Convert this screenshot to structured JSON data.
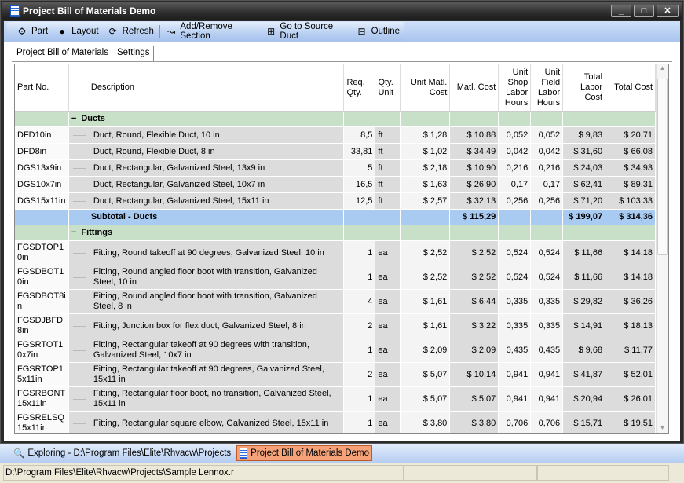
{
  "window": {
    "title": "Project Bill of Materials Demo",
    "controls": [
      "_",
      "□",
      "✕"
    ]
  },
  "toolbar": [
    {
      "label": "Part",
      "icon": "part-icon",
      "glyph": "⚙"
    },
    {
      "label": "Layout",
      "icon": "layout-icon",
      "glyph": "●"
    },
    {
      "label": "Refresh",
      "icon": "refresh-icon",
      "glyph": "⟳"
    },
    {
      "label": "Add/Remove Section",
      "icon": "add-remove-section-icon",
      "glyph": "↝"
    },
    {
      "label": "Go to Source Duct",
      "icon": "source-duct-icon",
      "glyph": "⊞"
    },
    {
      "label": "Outline",
      "icon": "outline-icon",
      "glyph": "⊟"
    }
  ],
  "tabs": [
    {
      "label": "Project Bill of Materials",
      "active": true
    },
    {
      "label": "Settings",
      "active": false
    }
  ],
  "table": {
    "columns": [
      "Part No.",
      "Description",
      "Req. Qty.",
      "Qty. Unit",
      "Unit Matl. Cost",
      "Matl. Cost",
      "Unit Shop Labor Hours",
      "Unit Field Labor Hours",
      "Total Labor Cost",
      "Total Cost"
    ],
    "rows": [
      {
        "type": "section",
        "label": "Ducts",
        "toggle": "−"
      },
      {
        "type": "item",
        "cells": [
          "DFD10in",
          "Duct, Round, Flexible Duct, 10 in",
          "8,5",
          "ft",
          "$ 1,28",
          "$ 10,88",
          "0,052",
          "0,052",
          "$ 9,83",
          "$ 20,71"
        ]
      },
      {
        "type": "item",
        "cells": [
          "DFD8in",
          "Duct, Round, Flexible Duct, 8 in",
          "33,81",
          "ft",
          "$ 1,02",
          "$ 34,49",
          "0,042",
          "0,042",
          "$ 31,60",
          "$ 66,08"
        ]
      },
      {
        "type": "item",
        "cells": [
          "DGS13x9in",
          "Duct, Rectangular, Galvanized Steel, 13x9 in",
          "5",
          "ft",
          "$ 2,18",
          "$ 10,90",
          "0,216",
          "0,216",
          "$ 24,03",
          "$ 34,93"
        ]
      },
      {
        "type": "item",
        "cells": [
          "DGS10x7in",
          "Duct, Rectangular, Galvanized Steel, 10x7 in",
          "16,5",
          "ft",
          "$ 1,63",
          "$ 26,90",
          "0,17",
          "0,17",
          "$ 62,41",
          "$ 89,31"
        ]
      },
      {
        "type": "item",
        "cells": [
          "DGS15x11in",
          "Duct, Rectangular, Galvanized Steel, 15x11 in",
          "12,5",
          "ft",
          "$ 2,57",
          "$ 32,13",
          "0,256",
          "0,256",
          "$ 71,20",
          "$ 103,33"
        ]
      },
      {
        "type": "subtotal",
        "cells": [
          "",
          "Subtotal - Ducts",
          "",
          "",
          "",
          "$ 115,29",
          "",
          "",
          "$ 199,07",
          "$ 314,36"
        ]
      },
      {
        "type": "section",
        "label": "Fittings",
        "toggle": "−"
      },
      {
        "type": "item",
        "tall": true,
        "cells": [
          "FGSDTOP10in",
          "Fitting, Round takeoff at 90 degrees, Galvanized Steel, 10 in",
          "1",
          "ea",
          "$ 2,52",
          "$ 2,52",
          "0,524",
          "0,524",
          "$ 11,66",
          "$ 14,18"
        ]
      },
      {
        "type": "item",
        "tall": true,
        "cells": [
          "FGSDBOT10in",
          "Fitting, Round angled floor boot with transition, Galvanized Steel, 10 in",
          "1",
          "ea",
          "$ 2,52",
          "$ 2,52",
          "0,524",
          "0,524",
          "$ 11,66",
          "$ 14,18"
        ]
      },
      {
        "type": "item",
        "tall": true,
        "cells": [
          "FGSDBOT8in",
          "Fitting, Round angled floor boot with transition, Galvanized Steel, 8 in",
          "4",
          "ea",
          "$ 1,61",
          "$ 6,44",
          "0,335",
          "0,335",
          "$ 29,82",
          "$ 36,26"
        ]
      },
      {
        "type": "item",
        "tall": true,
        "cells": [
          "FGSDJBFD8in",
          "Fitting, Junction box for flex duct, Galvanized Steel, 8 in",
          "2",
          "ea",
          "$ 1,61",
          "$ 3,22",
          "0,335",
          "0,335",
          "$ 14,91",
          "$ 18,13"
        ]
      },
      {
        "type": "item",
        "tall": true,
        "cells": [
          "FGSRTOT10x7in",
          "Fitting, Rectangular takeoff at 90 degrees with transition, Galvanized Steel, 10x7 in",
          "1",
          "ea",
          "$ 2,09",
          "$ 2,09",
          "0,435",
          "0,435",
          "$ 9,68",
          "$ 11,77"
        ]
      },
      {
        "type": "item",
        "tall": true,
        "cells": [
          "FGSRTOP15x11in",
          "Fitting, Rectangular takeoff at 90 degrees, Galvanized Steel, 15x11 in",
          "2",
          "ea",
          "$ 5,07",
          "$ 10,14",
          "0,941",
          "0,941",
          "$ 41,87",
          "$ 52,01"
        ]
      },
      {
        "type": "item",
        "tall": true,
        "cells": [
          "FGSRBONT15x11in",
          "Fitting, Rectangular floor boot, no transition, Galvanized Steel, 15x11 in",
          "1",
          "ea",
          "$ 5,07",
          "$ 5,07",
          "0,941",
          "0,941",
          "$ 20,94",
          "$ 26,01"
        ]
      },
      {
        "type": "item",
        "tall": true,
        "cells": [
          "FGSRELSQ15x11in",
          "Fitting, Rectangular square elbow, Galvanized Steel, 15x11 in",
          "1",
          "ea",
          "$ 3,80",
          "$ 3,80",
          "0,706",
          "0,706",
          "$ 15,71",
          "$ 19,51"
        ]
      }
    ]
  },
  "taskbar": [
    {
      "label": "Exploring - D:\\Program Files\\Elite\\Rhvacw\\Projects",
      "active": false
    },
    {
      "label": "Project Bill of Materials Demo",
      "active": true
    }
  ],
  "status": {
    "path": "D:\\Program Files\\Elite\\Rhvacw\\Projects\\Sample Lennox.r",
    "panel2": "",
    "panel3": ""
  },
  "colors": {
    "section": "#c8dfc8",
    "subtotal": "#a9cbf2",
    "active_task": "#f5a27a"
  }
}
